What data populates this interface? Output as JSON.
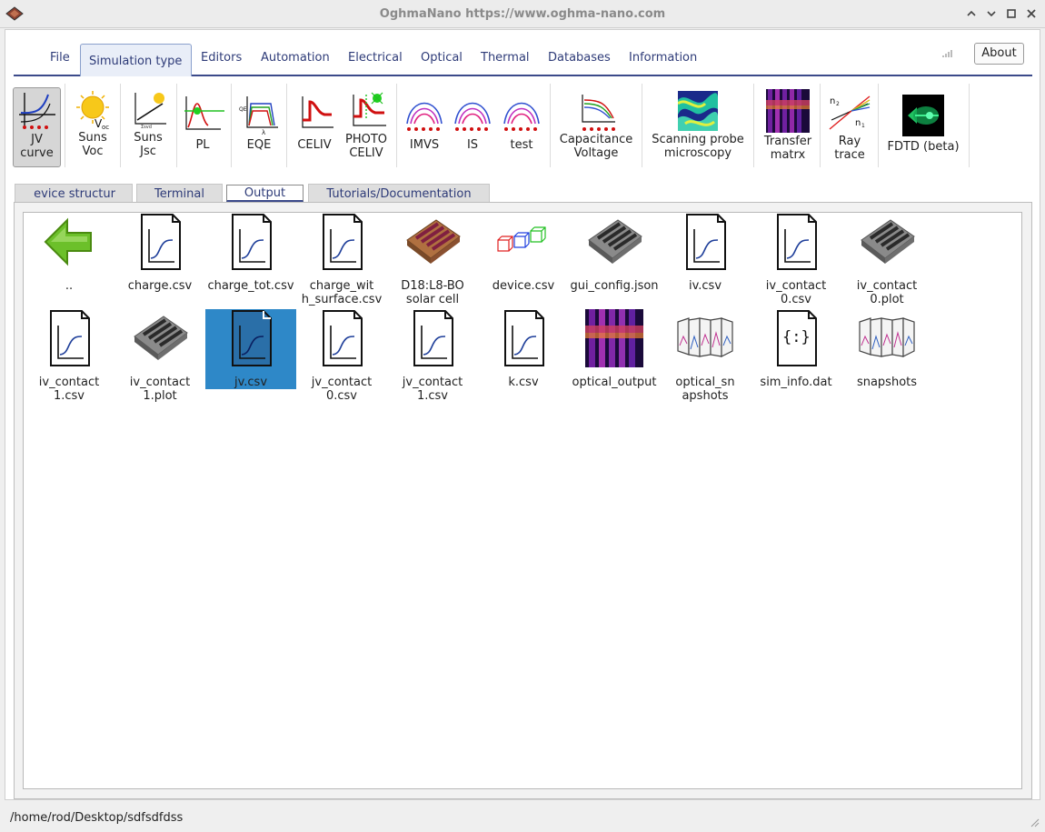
{
  "window": {
    "title": "OghmaNano https://www.oghma-nano.com"
  },
  "menu": {
    "items": [
      "File",
      "Simulation type",
      "Editors",
      "Automation",
      "Electrical",
      "Optical",
      "Thermal",
      "Databases",
      "Information"
    ],
    "active": "Simulation type",
    "about_label": "About"
  },
  "toolbar": {
    "jv": "JV\ncurve",
    "suns_voc": "Suns\nVoc",
    "suns_jsc": "Suns\nJsc",
    "pl": "PL",
    "eqe": "EQE",
    "celiv": "CELIV",
    "photo_celiv": "PHOTO\nCELIV",
    "imvs": "IMVS",
    "is": "IS",
    "test": "test",
    "cv": "Capacitance\nVoltage",
    "spm": "Scanning probe\nmicroscopy",
    "tm": "Transfer\nmatrx",
    "ray": "Ray\ntrace",
    "fdtd": "FDTD (beta)"
  },
  "tabs": {
    "device": "evice structur",
    "terminal": "Terminal",
    "output": "Output",
    "tutorials": "Tutorials/Documentation"
  },
  "files": [
    {
      "name": "..",
      "icon": "back-arrow-icon"
    },
    {
      "name": "charge.csv",
      "icon": "csv-file-icon"
    },
    {
      "name": "charge_tot.csv",
      "icon": "csv-file-icon"
    },
    {
      "name": "charge_wit\nh_surface.csv",
      "icon": "csv-file-icon"
    },
    {
      "name": "D18:L8-BO\nsolar cell",
      "icon": "solar-cell-icon"
    },
    {
      "name": "device.csv",
      "icon": "cubes-icon"
    },
    {
      "name": "gui_config.json",
      "icon": "device-chip-icon"
    },
    {
      "name": "iv.csv",
      "icon": "csv-file-icon"
    },
    {
      "name": "iv_contact\n0.csv",
      "icon": "csv-file-icon"
    },
    {
      "name": "iv_contact\n0.plot",
      "icon": "device-chip-icon"
    },
    {
      "name": "iv_contact\n1.csv",
      "icon": "csv-file-icon"
    },
    {
      "name": "iv_contact\n1.plot",
      "icon": "device-chip-icon"
    },
    {
      "name": "jv.csv",
      "icon": "csv-file-icon"
    },
    {
      "name": "jv_contact\n0.csv",
      "icon": "csv-file-icon"
    },
    {
      "name": "jv_contact\n1.csv",
      "icon": "csv-file-icon"
    },
    {
      "name": "k.csv",
      "icon": "csv-file-icon"
    },
    {
      "name": "optical_output",
      "icon": "optical-map-icon"
    },
    {
      "name": "optical_sn\napshots",
      "icon": "snapshots-icon"
    },
    {
      "name": "sim_info.dat",
      "icon": "json-file-icon"
    },
    {
      "name": "snapshots",
      "icon": "snapshots-icon"
    }
  ],
  "selected_file": "jv.csv",
  "status": {
    "path": "/home/rod/Desktop/sdfsdfdss"
  },
  "colors": {
    "accent": "#3b4a8a",
    "selection": "#2e88c8",
    "menu_text": "#2e3b78"
  }
}
